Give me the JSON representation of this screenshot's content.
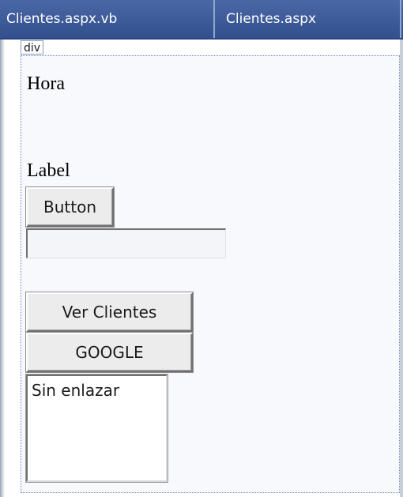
{
  "tabs": [
    {
      "label": "Clientes.aspx.vb"
    },
    {
      "label": "Clientes.aspx"
    }
  ],
  "designer": {
    "div_tag": "div",
    "hora_text": "Hora",
    "label_text": "Label",
    "button_label": "Button",
    "textbox_value": "",
    "ver_clientes_label": "Ver Clientes",
    "google_label": "GOOGLE",
    "listbox_items": [
      "Sin enlazar"
    ]
  },
  "colors": {
    "tab_strip": "#3c5a9a",
    "tab_text": "#ffffff",
    "container_border": "#6b86b8"
  }
}
